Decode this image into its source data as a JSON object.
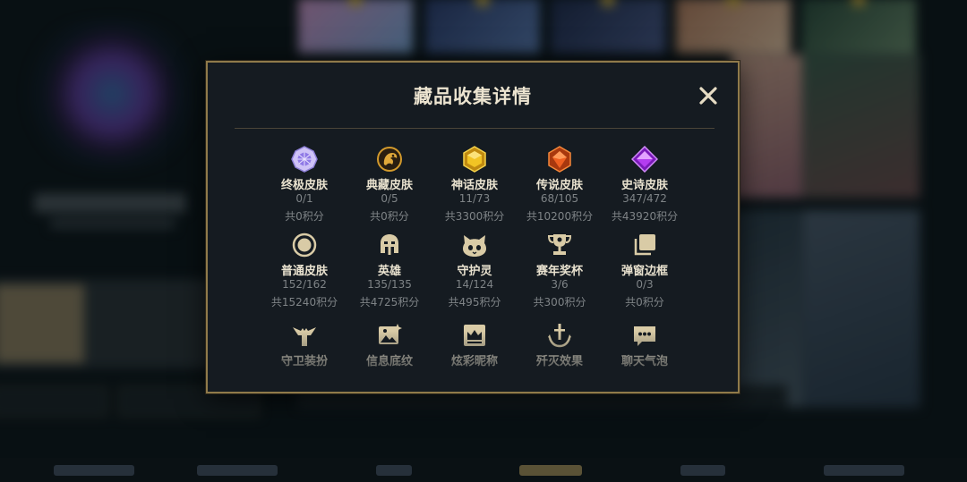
{
  "modal": {
    "title": "藏品收集详情",
    "close_glyph": "✕",
    "items": [
      {
        "name": "终极皮肤",
        "count": "0/1",
        "points": "共0积分",
        "icon": "ultimate-gem-icon",
        "color": "#b9a7ff"
      },
      {
        "name": "典藏皮肤",
        "count": "0/5",
        "points": "共0积分",
        "icon": "dragon-emblem-icon",
        "color": "#d39a2c"
      },
      {
        "name": "神话皮肤",
        "count": "11/73",
        "points": "共3300积分",
        "icon": "mythic-gem-icon",
        "color": "#f0c12b"
      },
      {
        "name": "传说皮肤",
        "count": "68/105",
        "points": "共10200积分",
        "icon": "legendary-gem-icon",
        "color": "#f0611f"
      },
      {
        "name": "史诗皮肤",
        "count": "347/472",
        "points": "共43920积分",
        "icon": "epic-gem-icon",
        "color": "#b43cf0"
      },
      {
        "name": "普通皮肤",
        "count": "152/162",
        "points": "共15240积分",
        "icon": "standard-circle-icon",
        "color": "#d9cba6"
      },
      {
        "name": "英雄",
        "count": "135/135",
        "points": "共4725积分",
        "icon": "helmet-icon",
        "color": "#d9cba6"
      },
      {
        "name": "守护灵",
        "count": "14/124",
        "points": "共495积分",
        "icon": "little-legend-icon",
        "color": "#d9cba6"
      },
      {
        "name": "赛年奖杯",
        "count": "3/6",
        "points": "共300积分",
        "icon": "trophy-icon",
        "color": "#d9cba6"
      },
      {
        "name": "弹窗边框",
        "count": "0/3",
        "points": "共0积分",
        "icon": "frame-stack-icon",
        "color": "#d9cba6"
      },
      {
        "name": "守卫装扮",
        "count": "",
        "points": "",
        "icon": "ward-icon",
        "color": "#d9cba6"
      },
      {
        "name": "信息底纹",
        "count": "",
        "points": "",
        "icon": "banner-image-icon",
        "color": "#d9cba6"
      },
      {
        "name": "炫彩昵称",
        "count": "",
        "points": "",
        "icon": "crown-card-icon",
        "color": "#d9cba6"
      },
      {
        "name": "歼灭效果",
        "count": "",
        "points": "",
        "icon": "sword-icon",
        "color": "#d9cba6"
      },
      {
        "name": "聊天气泡",
        "count": "",
        "points": "",
        "icon": "chat-bubble-icon",
        "color": "#d9cba6"
      }
    ]
  },
  "colors": {
    "modal_border": "#8f7a4a",
    "modal_bg": "#151b21",
    "title_text": "#ece4d0",
    "muted_text": "#7e8386",
    "close_color": "#e6dcc4"
  }
}
